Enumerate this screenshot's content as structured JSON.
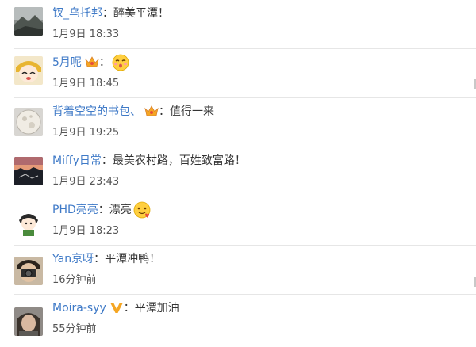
{
  "comments": [
    {
      "name": "钗_乌托邦",
      "badge": "",
      "message": "醉美平潭！",
      "emoji": "",
      "time": "1月9日 18:33",
      "avatar": "mountain-photo-avatar"
    },
    {
      "name": "5月呢",
      "badge": "crown-badge",
      "message": "",
      "emoji": "kissing-face-emoji",
      "time": "1月9日 18:45",
      "avatar": "cartoon-girl-avatar"
    },
    {
      "name": "背着空空的书包、",
      "badge": "crown-badge",
      "message": "值得一来",
      "emoji": "",
      "time": "1月9日 19:25",
      "avatar": "moon-avatar"
    },
    {
      "name": "Miffy日常",
      "badge": "",
      "message": "最美农村路，百姓致富路！",
      "emoji": "",
      "time": "1月9日 23:43",
      "avatar": "sunset-photo-avatar"
    },
    {
      "name": "PHD亮亮",
      "badge": "",
      "message": "漂亮",
      "emoji": "heart-face-emoji",
      "time": "1月9日 18:23",
      "avatar": "anime-boy-avatar"
    },
    {
      "name": "Yan京呀",
      "badge": "",
      "message": "平潭冲鸭！",
      "emoji": "",
      "time": "16分钟前",
      "avatar": "camera-person-avatar"
    },
    {
      "name": "Moira-syy",
      "badge": "v-badge",
      "message": "平潭加油",
      "emoji": "",
      "time": "55分钟前",
      "avatar": "woman-photo-avatar"
    }
  ],
  "colors": {
    "name": "#3f7ac7",
    "text": "#333333",
    "time": "#555555",
    "divider": "#e6e6e6",
    "badge_gold": "#f5a623"
  }
}
